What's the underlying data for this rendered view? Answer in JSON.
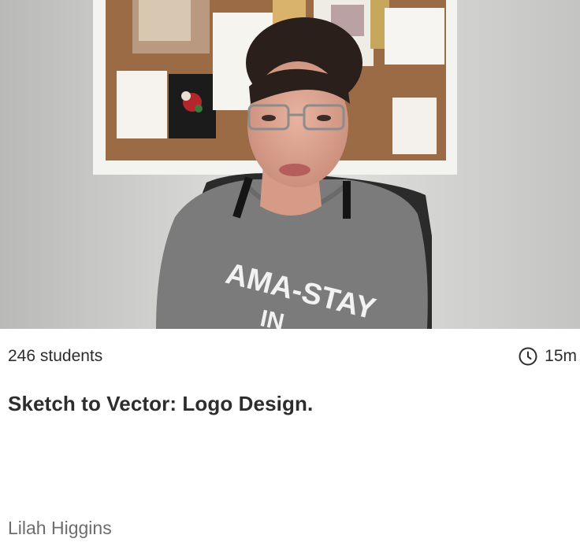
{
  "class_card": {
    "thumbnail": {
      "alt_subject": "instructor-video-frame",
      "shirt_text_line1": "AMA-STAY",
      "shirt_text_line2": "IN"
    },
    "students_label": "246 students",
    "duration_icon": "clock-icon",
    "duration_label": "15m",
    "title": "Sketch to Vector: Logo Design.",
    "teacher_name": "Lilah Higgins"
  },
  "colors": {
    "text_primary": "#2d2d2d",
    "text_secondary": "#6d6d6d",
    "background": "#ffffff"
  }
}
